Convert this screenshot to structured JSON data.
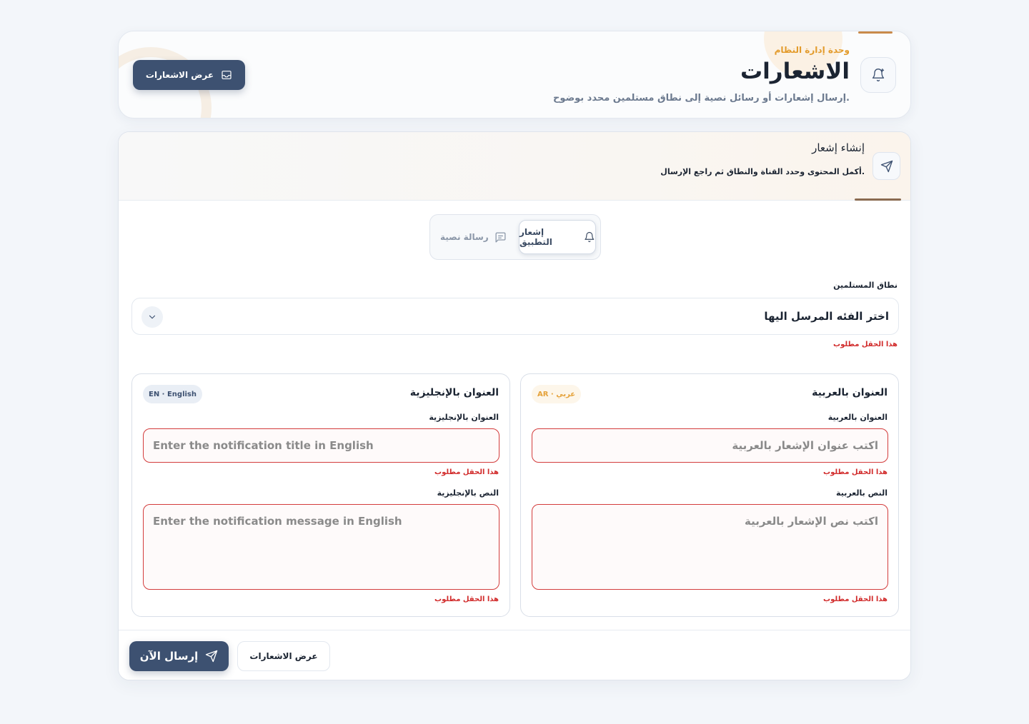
{
  "header": {
    "kicker": "وحدة إدارة النظام",
    "title": "الاشعارات",
    "subtitle": "إرسال إشعارات أو رسائل نصية إلى نطاق مستلمين محدد بوضوح.",
    "view_button": "عرض الاشعارات",
    "icon": "bell-plus-icon"
  },
  "compose": {
    "title": "إنشاء إشعار",
    "subtitle": "أكمل المحتوى وحدد القناة والنطاق ثم راجع الإرسال.",
    "icon": "send-icon"
  },
  "channels": [
    {
      "label": "إشعار التطبيق",
      "icon": "bell-icon",
      "active": true
    },
    {
      "label": "رسالة نصية",
      "icon": "message-icon",
      "active": false
    }
  ],
  "recipients": {
    "label": "نطاق المستلمين",
    "selected": "اختر الفئه المرسل اليها",
    "error": "هذا الحقل مطلوب"
  },
  "arabic": {
    "panel_title": "العنوان بالعربية",
    "badge": "AR · عربي",
    "title_label": "العنوان بالعربية",
    "title_placeholder": "اكتب عنوان الإشعار بالعربية",
    "title_error": "هذا الحقل مطلوب",
    "body_label": "النص بالعربية",
    "body_placeholder": "اكتب نص الإشعار بالعربية",
    "body_error": "هذا الحقل مطلوب"
  },
  "english": {
    "panel_title": "العنوان بالإنجليزية",
    "badge": "EN · English",
    "title_label": "العنوان بالإنجليزية",
    "title_placeholder": "Enter the notification title in English",
    "title_error": "هذا الحقل مطلوب",
    "body_label": "النص بالإنجليزية",
    "body_placeholder": "Enter the notification message in English",
    "body_error": "هذا الحقل مطلوب"
  },
  "footer": {
    "send_button": "إرسال الآن",
    "view_button": "عرض الاشعارات"
  },
  "colors": {
    "accent_dark": "#3d5171",
    "accent_orange": "#e39b2b",
    "error": "#d12a2a"
  }
}
